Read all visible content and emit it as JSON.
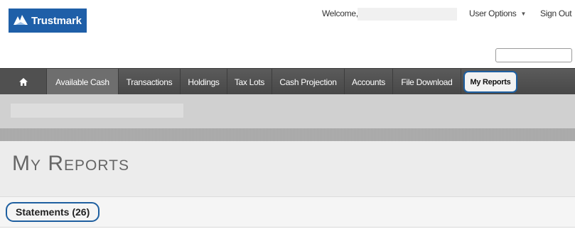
{
  "header": {
    "brand": "Trustmark",
    "welcome_label": "Welcome,",
    "user_options_label": "User Options",
    "sign_out_label": "Sign Out",
    "search_value": ""
  },
  "nav": {
    "items": [
      {
        "label": "Available Cash"
      },
      {
        "label": "Transactions"
      },
      {
        "label": "Holdings"
      },
      {
        "label": "Tax Lots"
      },
      {
        "label": "Cash Projection"
      },
      {
        "label": "Accounts"
      },
      {
        "label": "File Download"
      },
      {
        "label": "My Reports",
        "active": true
      }
    ]
  },
  "page": {
    "title": "My Reports"
  },
  "section": {
    "title": "Statements (26)"
  },
  "colors": {
    "brand_blue": "#1f5fa8",
    "nav_bg": "#505050",
    "highlight_outline": "#1e5fa0"
  },
  "icons": [
    "trustmark-logo-icon",
    "chevron-down-icon",
    "home-icon"
  ]
}
